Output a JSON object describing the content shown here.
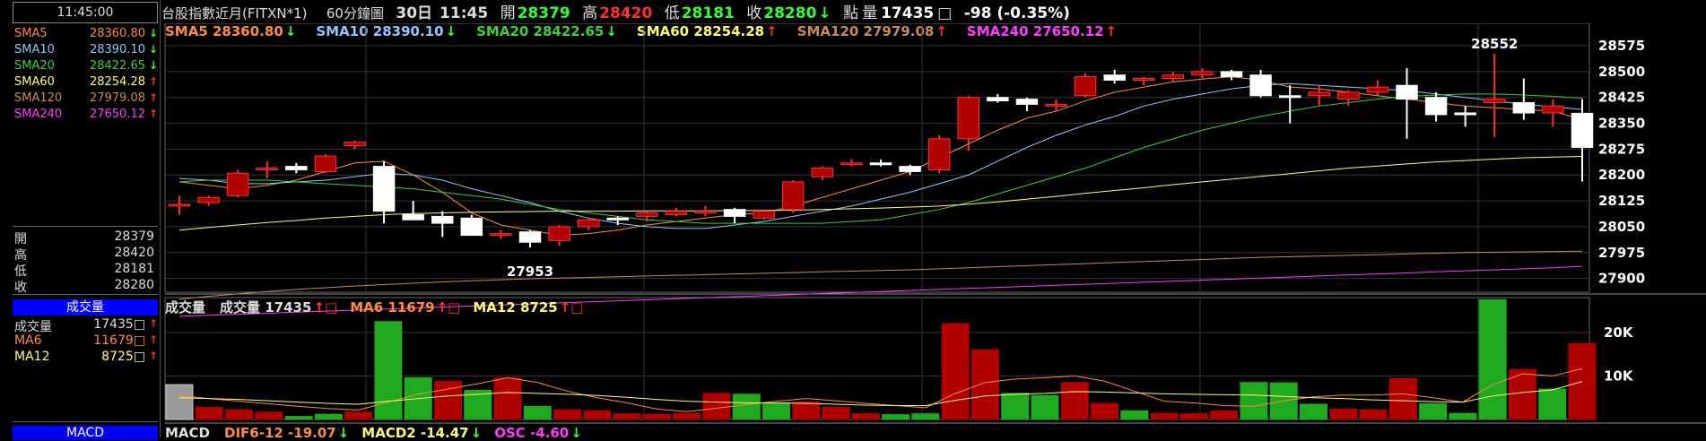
{
  "time": "11:45:00",
  "header": {
    "title": "台股指數近月(FITXN*1)",
    "interval": "60分鐘圖",
    "date": "30日",
    "clock": "11:45",
    "open_label": "開",
    "open": "28379",
    "high_label": "高",
    "high": "28420",
    "low_label": "低",
    "low": "28181",
    "close_label": "收",
    "close": "28280",
    "close_arrow": "↓",
    "pts_label": "點",
    "volume_label": "量",
    "volume": "17435",
    "box": "□",
    "change": "-98 (-0.35%)"
  },
  "sma_panel": [
    {
      "label": "SMA5",
      "value": "28360.80",
      "dir": "down",
      "color": "#ff8c3c"
    },
    {
      "label": "SMA10",
      "value": "28390.10",
      "dir": "down",
      "color": "#8cc8ff"
    },
    {
      "label": "SMA20",
      "value": "28422.65",
      "dir": "down",
      "color": "#3cd03c"
    },
    {
      "label": "SMA60",
      "value": "28254.28",
      "dir": "up",
      "color": "#ffff6e"
    },
    {
      "label": "SMA120",
      "value": "27979.08",
      "dir": "up",
      "color": "#c88c50"
    },
    {
      "label": "SMA240",
      "value": "27650.12",
      "dir": "up",
      "color": "#ff3cff"
    }
  ],
  "legend": [
    {
      "text": "SMA5 28360.80",
      "arrow": "↓",
      "color": "#ff8c3c"
    },
    {
      "text": "SMA10 28390.10",
      "arrow": "↓",
      "color": "#8cc8ff"
    },
    {
      "text": "SMA20 28422.65",
      "arrow": "↓",
      "color": "#3cd03c"
    },
    {
      "text": "SMA60 28254.28",
      "arrow": "↑",
      "color": "#ffff6e"
    },
    {
      "text": "SMA120 27979.08",
      "arrow": "↑",
      "color": "#c88c50"
    },
    {
      "text": "SMA240 27650.12",
      "arrow": "↑",
      "color": "#ff3cff"
    }
  ],
  "ohlc_panel": [
    {
      "label": "開",
      "value": "28379"
    },
    {
      "label": "高",
      "value": "28420"
    },
    {
      "label": "低",
      "value": "28181"
    },
    {
      "label": "收",
      "value": "28280"
    }
  ],
  "volume_panel": {
    "title": "成交量",
    "rows": [
      {
        "label": "成交量",
        "value": "17435□",
        "color": "#ddd"
      },
      {
        "label": "MA6",
        "value": "11679□",
        "color": "#ff8c3c"
      },
      {
        "label": "MA12",
        "value": "8725□",
        "color": "#ffff6e"
      }
    ]
  },
  "vol_legend": [
    {
      "text": "成交量",
      "color": "#ddd"
    },
    {
      "text": "成交量 17435",
      "arrow": "↑□",
      "color": "#ddd"
    },
    {
      "text": "MA6 11679",
      "arrow": "↑□",
      "color": "#ff8c3c"
    },
    {
      "text": "MA12 8725",
      "arrow": "↑□",
      "color": "#ffff6e"
    }
  ],
  "macd_panel": {
    "title": "MACD"
  },
  "macd_legend": [
    {
      "text": "MACD",
      "color": "#ddd"
    },
    {
      "text": "DIF6-12 -19.07",
      "arrow": "↓",
      "color": "#ff8c3c"
    },
    {
      "text": "MACD2 -14.47",
      "arrow": "↓",
      "color": "#ffff6e"
    },
    {
      "text": "OSC -4.60",
      "arrow": "↓",
      "color": "#ff3cff"
    }
  ],
  "chart_data": {
    "type": "candlestick",
    "y_ticks": [
      "28575",
      "28500",
      "28425",
      "28350",
      "28275",
      "28200",
      "28125",
      "28050",
      "27975",
      "27900"
    ],
    "ylim": [
      27860,
      28640
    ],
    "annotations": [
      {
        "text": "28552",
        "value": 28552
      },
      {
        "text": "27953",
        "value": 27953
      }
    ],
    "candles": [
      {
        "o": 28115,
        "h": 28140,
        "l": 28085,
        "c": 28115
      },
      {
        "o": 28120,
        "h": 28140,
        "l": 28110,
        "c": 28135
      },
      {
        "o": 28140,
        "h": 28215,
        "l": 28135,
        "c": 28205
      },
      {
        "o": 28215,
        "h": 28240,
        "l": 28190,
        "c": 28220
      },
      {
        "o": 28225,
        "h": 28235,
        "l": 28205,
        "c": 28215
      },
      {
        "o": 28210,
        "h": 28260,
        "l": 28205,
        "c": 28255
      },
      {
        "o": 28285,
        "h": 28300,
        "l": 28275,
        "c": 28295
      },
      {
        "o": 28225,
        "h": 28240,
        "l": 28060,
        "c": 28095
      },
      {
        "o": 28085,
        "h": 28125,
        "l": 28070,
        "c": 28070
      },
      {
        "o": 28080,
        "h": 28095,
        "l": 28020,
        "c": 28060
      },
      {
        "o": 28075,
        "h": 28085,
        "l": 28025,
        "c": 28025
      },
      {
        "o": 28025,
        "h": 28040,
        "l": 28015,
        "c": 28030
      },
      {
        "o": 28035,
        "h": 28040,
        "l": 27990,
        "c": 28005
      },
      {
        "o": 28010,
        "h": 28055,
        "l": 27995,
        "c": 28050
      },
      {
        "o": 28050,
        "h": 28075,
        "l": 28040,
        "c": 28070
      },
      {
        "o": 28075,
        "h": 28080,
        "l": 28055,
        "c": 28070
      },
      {
        "o": 28080,
        "h": 28095,
        "l": 28065,
        "c": 28090
      },
      {
        "o": 28085,
        "h": 28105,
        "l": 28080,
        "c": 28095
      },
      {
        "o": 28095,
        "h": 28110,
        "l": 28080,
        "c": 28095
      },
      {
        "o": 28100,
        "h": 28105,
        "l": 28060,
        "c": 28080
      },
      {
        "o": 28075,
        "h": 28095,
        "l": 28070,
        "c": 28095
      },
      {
        "o": 28100,
        "h": 28185,
        "l": 28090,
        "c": 28180
      },
      {
        "o": 28195,
        "h": 28225,
        "l": 28185,
        "c": 28220
      },
      {
        "o": 28230,
        "h": 28245,
        "l": 28225,
        "c": 28235
      },
      {
        "o": 28235,
        "h": 28245,
        "l": 28225,
        "c": 28230
      },
      {
        "o": 28225,
        "h": 28230,
        "l": 28200,
        "c": 28210
      },
      {
        "o": 28215,
        "h": 28315,
        "l": 28205,
        "c": 28305
      },
      {
        "o": 28305,
        "h": 28430,
        "l": 28270,
        "c": 28425
      },
      {
        "o": 28425,
        "h": 28435,
        "l": 28410,
        "c": 28415
      },
      {
        "o": 28420,
        "h": 28425,
        "l": 28385,
        "c": 28405
      },
      {
        "o": 28400,
        "h": 28420,
        "l": 28385,
        "c": 28405
      },
      {
        "o": 28430,
        "h": 28495,
        "l": 28425,
        "c": 28485
      },
      {
        "o": 28490,
        "h": 28505,
        "l": 28465,
        "c": 28475
      },
      {
        "o": 28475,
        "h": 28485,
        "l": 28460,
        "c": 28480
      },
      {
        "o": 28480,
        "h": 28500,
        "l": 28470,
        "c": 28490
      },
      {
        "o": 28490,
        "h": 28510,
        "l": 28480,
        "c": 28500
      },
      {
        "o": 28500,
        "h": 28505,
        "l": 28475,
        "c": 28485
      },
      {
        "o": 28490,
        "h": 28505,
        "l": 28425,
        "c": 28430
      },
      {
        "o": 28430,
        "h": 28460,
        "l": 28350,
        "c": 28425
      },
      {
        "o": 28430,
        "h": 28460,
        "l": 28400,
        "c": 28440
      },
      {
        "o": 28420,
        "h": 28445,
        "l": 28400,
        "c": 28440
      },
      {
        "o": 28440,
        "h": 28475,
        "l": 28430,
        "c": 28455
      },
      {
        "o": 28460,
        "h": 28510,
        "l": 28305,
        "c": 28420
      },
      {
        "o": 28425,
        "h": 28440,
        "l": 28355,
        "c": 28375
      },
      {
        "o": 28380,
        "h": 28400,
        "l": 28340,
        "c": 28375
      },
      {
        "o": 28410,
        "h": 28552,
        "l": 28310,
        "c": 28420
      },
      {
        "o": 28410,
        "h": 28480,
        "l": 28360,
        "c": 28380
      },
      {
        "o": 28380,
        "h": 28420,
        "l": 28340,
        "c": 28400
      },
      {
        "o": 28379,
        "h": 28420,
        "l": 28181,
        "c": 28280
      }
    ],
    "series": [
      {
        "name": "SMA5",
        "values": [
          28180,
          28170,
          28160,
          28170,
          28185,
          28210,
          28235,
          28240,
          28200,
          28150,
          28090,
          28055,
          28040,
          28025,
          28030,
          28040,
          28055,
          28065,
          28075,
          28085,
          28090,
          28110,
          28135,
          28160,
          28185,
          28210,
          28250,
          28290,
          28330,
          28365,
          28385,
          28415,
          28440,
          28455,
          28470,
          28478,
          28485,
          28475,
          28455,
          28450,
          28440,
          28430,
          28420,
          28410,
          28400,
          28395,
          28390,
          28385,
          28361
        ]
      },
      {
        "name": "SMA10",
        "values": [
          28190,
          28185,
          28175,
          28175,
          28180,
          28185,
          28195,
          28205,
          28200,
          28185,
          28160,
          28140,
          28120,
          28095,
          28075,
          28060,
          28050,
          28045,
          28045,
          28055,
          28065,
          28080,
          28095,
          28110,
          28130,
          28150,
          28175,
          28200,
          28240,
          28280,
          28315,
          28345,
          28370,
          28400,
          28420,
          28435,
          28450,
          28460,
          28465,
          28460,
          28455,
          28450,
          28445,
          28435,
          28425,
          28415,
          28405,
          28398,
          28390
        ]
      },
      {
        "name": "SMA20",
        "values": [
          28180,
          28185,
          28185,
          28185,
          28180,
          28175,
          28170,
          28165,
          28160,
          28150,
          28140,
          28130,
          28115,
          28100,
          28090,
          28080,
          28070,
          28065,
          28060,
          28060,
          28060,
          28060,
          28060,
          28065,
          28070,
          28085,
          28100,
          28120,
          28145,
          28170,
          28195,
          28220,
          28250,
          28280,
          28305,
          28330,
          28350,
          28370,
          28385,
          28400,
          28410,
          28420,
          28428,
          28432,
          28435,
          28435,
          28432,
          28428,
          28423
        ]
      },
      {
        "name": "SMA60",
        "values": [
          28040,
          28048,
          28055,
          28062,
          28068,
          28075,
          28080,
          28085,
          28088,
          28090,
          28092,
          28093,
          28094,
          28095,
          28095,
          28095,
          28096,
          28096,
          28096,
          28097,
          28097,
          28098,
          28100,
          28102,
          28104,
          28107,
          28110,
          28115,
          28122,
          28130,
          28138,
          28147,
          28155,
          28163,
          28172,
          28180,
          28188,
          28196,
          28204,
          28212,
          28220,
          28226,
          28232,
          28238,
          28242,
          28246,
          28250,
          28252,
          28254
        ]
      },
      {
        "name": "SMA120",
        "values": [
          27840,
          27848,
          27855,
          27862,
          27868,
          27873,
          27878,
          27882,
          27886,
          27890,
          27893,
          27896,
          27899,
          27901,
          27903,
          27905,
          27907,
          27909,
          27911,
          27913,
          27915,
          27917,
          27919,
          27921,
          27923,
          27925,
          27928,
          27931,
          27934,
          27937,
          27940,
          27943,
          27946,
          27949,
          27952,
          27955,
          27958,
          27961,
          27963,
          27965,
          27967,
          27969,
          27971,
          27973,
          27975,
          27976,
          27977,
          27978,
          27979
        ]
      },
      {
        "name": "SMA240",
        "values": [
          27790,
          27793,
          27796,
          27799,
          27802,
          27805,
          27808,
          27811,
          27814,
          27817,
          27820,
          27823,
          27826,
          27829,
          27832,
          27835,
          27838,
          27841,
          27844,
          27847,
          27850,
          27853,
          27856,
          27859,
          27862,
          27865,
          27868,
          27871,
          27874,
          27877,
          27880,
          27883,
          27886,
          27889,
          27892,
          27895,
          27898,
          27901,
          27904,
          27907,
          27910,
          27913,
          27916,
          27919,
          27922,
          27925,
          27928,
          27931,
          27935
        ]
      }
    ],
    "volume": {
      "ylim": [
        0,
        28000
      ],
      "y_ticks": [
        "20K",
        "10K"
      ],
      "values": [
        8000,
        2800,
        2200,
        1700,
        700,
        1200,
        1700,
        22500,
        9600,
        8800,
        6700,
        9500,
        3000,
        2200,
        2000,
        1300,
        1200,
        1400,
        6000,
        5800,
        3800,
        4000,
        2800,
        1300,
        1100,
        1300,
        22000,
        16000,
        6000,
        5500,
        8500,
        3700,
        2000,
        1400,
        1300,
        2000,
        8500,
        8400,
        3500,
        2400,
        2200,
        9400,
        3600,
        1400,
        27500,
        11500,
        7000,
        17435
      ],
      "ma6": [
        5500,
        4800,
        4200,
        3600,
        3000,
        2500,
        2200,
        4000,
        5800,
        7000,
        8200,
        9600,
        8500,
        6500,
        5000,
        3800,
        2400,
        1800,
        2600,
        3400,
        4200,
        4800,
        4300,
        3700,
        3200,
        2700,
        6000,
        8500,
        9300,
        9600,
        10000,
        8800,
        6500,
        4200,
        3800,
        3200,
        3000,
        4300,
        5200,
        5600,
        5600,
        5900,
        5000,
        4000,
        8000,
        10500,
        10000,
        11679
      ],
      "ma12": [
        5000,
        4800,
        4600,
        4300,
        4000,
        3700,
        3500,
        4200,
        4800,
        5400,
        5800,
        6200,
        6000,
        5800,
        5500,
        5100,
        4600,
        4200,
        4000,
        3800,
        3800,
        3700,
        3500,
        3300,
        3200,
        3200,
        4400,
        5400,
        5800,
        6000,
        6400,
        6300,
        6100,
        5900,
        5800,
        5700,
        5600,
        5300,
        5000,
        4800,
        4500,
        4300,
        4100,
        4000,
        5400,
        6200,
        6800,
        8725
      ],
      "colors": [
        "gray",
        "red",
        "red",
        "red",
        "green",
        "green",
        "red",
        "green",
        "green",
        "red",
        "green",
        "red",
        "green",
        "red",
        "red",
        "red",
        "red",
        "red",
        "red",
        "green",
        "green",
        "red",
        "red",
        "red",
        "green",
        "green",
        "red",
        "red",
        "green",
        "green",
        "red",
        "red",
        "green",
        "red",
        "red",
        "red",
        "green",
        "green",
        "green",
        "red",
        "red",
        "red",
        "green",
        "green",
        "green",
        "red",
        "green",
        "red",
        "green"
      ]
    }
  }
}
